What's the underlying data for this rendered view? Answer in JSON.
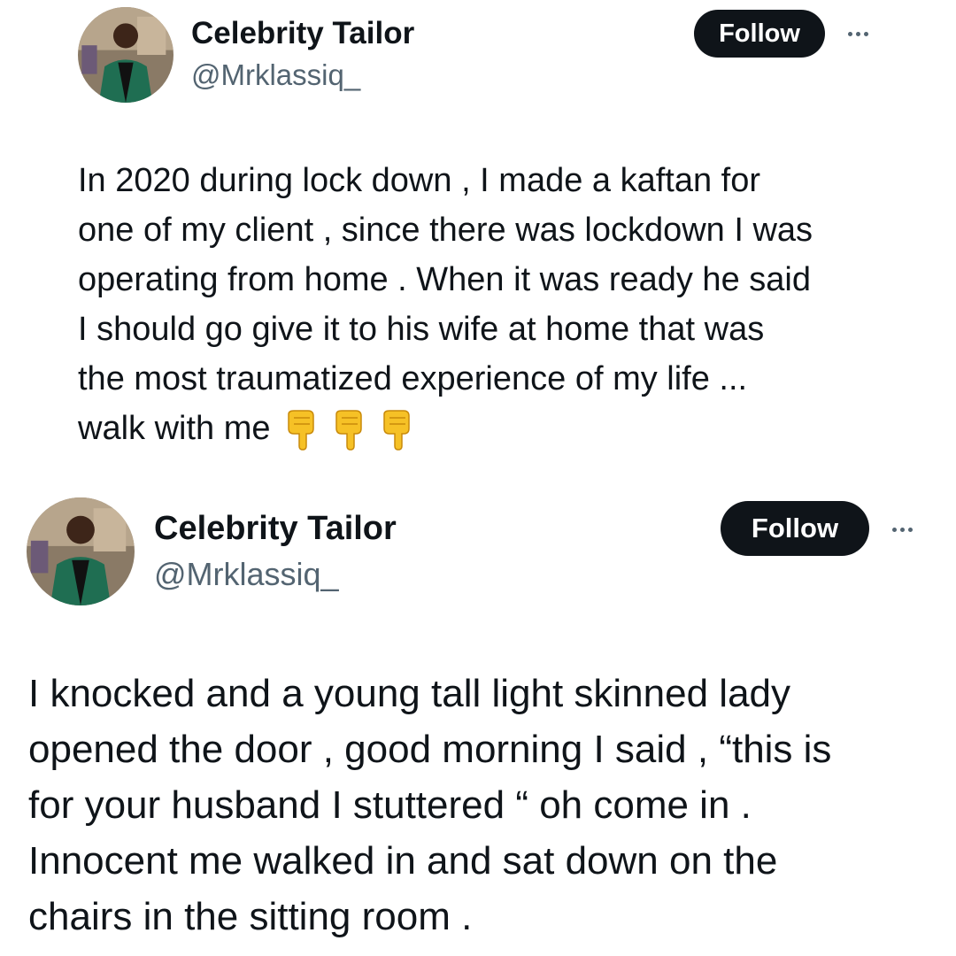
{
  "tweets": [
    {
      "author_name": "Celebrity Tailor",
      "author_handle": "@Mrklassiq_",
      "follow_label": "Follow",
      "avatar_icon": "avatar-photo",
      "text": "In 2020 during lock down , I made a kaftan for\none of my client , since there was lockdown I was\noperating from home . When it was ready he said\nI should go give it to his wife at home that was\nthe most traumatized experience of my life ...\nwalk with me",
      "emoji": [
        "backhand-index-pointing-down",
        "backhand-index-pointing-down",
        "backhand-index-pointing-down"
      ]
    },
    {
      "author_name": "Celebrity Tailor",
      "author_handle": "@Mrklassiq_",
      "follow_label": "Follow",
      "avatar_icon": "avatar-photo",
      "text": "I knocked and a young tall light skinned lady\nopened the door , good morning I said , “this is\nfor your husband I stuttered “  oh come in .\nInnocent me walked in and sat down on the\nchairs in the sitting room ."
    }
  ],
  "colors": {
    "text_primary": "#0f1419",
    "text_secondary": "#536471",
    "follow_bg": "#0f1419",
    "follow_text": "#ffffff",
    "emoji_yellow": "#f6c126"
  }
}
